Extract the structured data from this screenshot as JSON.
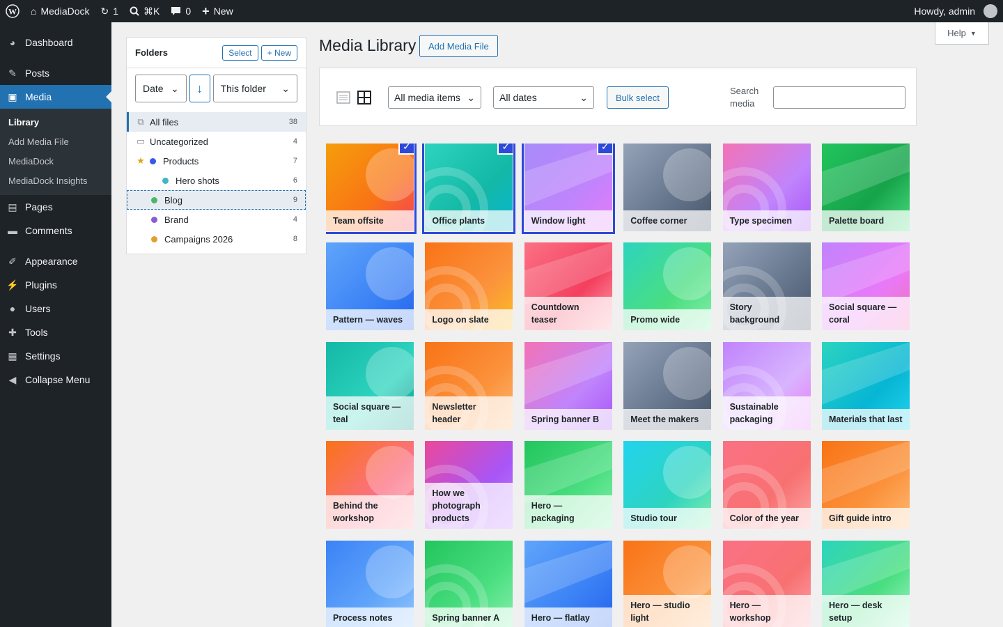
{
  "admin_bar": {
    "site_name": "MediaDock",
    "updates_count": "1",
    "search_shortcut": "⌘K",
    "comments_count": "0",
    "new_label": "New",
    "greeting": "Howdy, admin"
  },
  "sidebar": {
    "items": [
      {
        "label": "Dashboard",
        "icon": "dashboard-icon"
      },
      {
        "label": "Posts",
        "icon": "pin-icon"
      },
      {
        "label": "Media",
        "icon": "media-icon"
      },
      {
        "label": "Pages",
        "icon": "page-icon"
      },
      {
        "label": "Comments",
        "icon": "comment-icon"
      },
      {
        "label": "Appearance",
        "icon": "brush-icon"
      },
      {
        "label": "Plugins",
        "icon": "plug-icon"
      },
      {
        "label": "Users",
        "icon": "user-icon"
      },
      {
        "label": "Tools",
        "icon": "wrench-icon"
      },
      {
        "label": "Settings",
        "icon": "settings-icon"
      },
      {
        "label": "Collapse Menu",
        "icon": "collapse-icon"
      }
    ],
    "submenu": [
      "Library",
      "Add Media File",
      "MediaDock",
      "MediaDock Insights"
    ]
  },
  "folders": {
    "title": "Folders",
    "select_label": "Select",
    "new_label": "+ New",
    "sort_label": "Date",
    "scope_label": "This folder",
    "tree": [
      {
        "label": "All files",
        "count": "38"
      },
      {
        "label": "Uncategorized",
        "count": "4"
      },
      {
        "label": "Products",
        "count": "7",
        "color": "#3858e9"
      },
      {
        "label": "Hero shots",
        "count": "6",
        "color": "#3fb7c4"
      },
      {
        "label": "Blog",
        "count": "9",
        "color": "#4ab866"
      },
      {
        "label": "Brand",
        "count": "4",
        "color": "#8c5bd6"
      },
      {
        "label": "Campaigns 2026",
        "count": "8",
        "color": "#e0a030"
      }
    ]
  },
  "page": {
    "title": "Media Library",
    "add_button": "Add Media File",
    "help_label": "Help"
  },
  "toolbar": {
    "filter_type": "All media items",
    "filter_date": "All dates",
    "bulk_label": "Bulk select",
    "search_label": "Search media",
    "search_value": ""
  },
  "media_items": [
    {
      "title": "Team offsite",
      "selected": true
    },
    {
      "title": "Office plants",
      "selected": true
    },
    {
      "title": "Window light",
      "selected": true
    },
    {
      "title": "Coffee corner",
      "selected": false
    },
    {
      "title": "Type specimen",
      "selected": false
    },
    {
      "title": "Palette board",
      "selected": false
    },
    {
      "title": "Pattern — waves",
      "selected": false
    },
    {
      "title": "Logo on slate",
      "selected": false
    },
    {
      "title": "Countdown teaser",
      "selected": false
    },
    {
      "title": "Promo wide",
      "selected": false
    },
    {
      "title": "Story background",
      "selected": false
    },
    {
      "title": "Social square — coral",
      "selected": false
    },
    {
      "title": "Social square — teal",
      "selected": false
    },
    {
      "title": "Newsletter header",
      "selected": false
    },
    {
      "title": "Spring banner B",
      "selected": false
    },
    {
      "title": "Meet the makers",
      "selected": false
    },
    {
      "title": "Sustainable packaging",
      "selected": false
    },
    {
      "title": "Materials that last",
      "selected": false
    },
    {
      "title": "Behind the workshop",
      "selected": false
    },
    {
      "title": "How we photograph products",
      "selected": false
    },
    {
      "title": "Hero — packaging",
      "selected": false
    },
    {
      "title": "Studio tour",
      "selected": false
    },
    {
      "title": "Color of the year",
      "selected": false
    },
    {
      "title": "Gift guide intro",
      "selected": false
    },
    {
      "title": "Process notes",
      "selected": false
    },
    {
      "title": "Spring banner A",
      "selected": false
    },
    {
      "title": "Hero — flatlay",
      "selected": false
    },
    {
      "title": "Hero — studio light",
      "selected": false
    },
    {
      "title": "Hero — workshop",
      "selected": false
    },
    {
      "title": "Hero — desk setup",
      "selected": false
    }
  ]
}
